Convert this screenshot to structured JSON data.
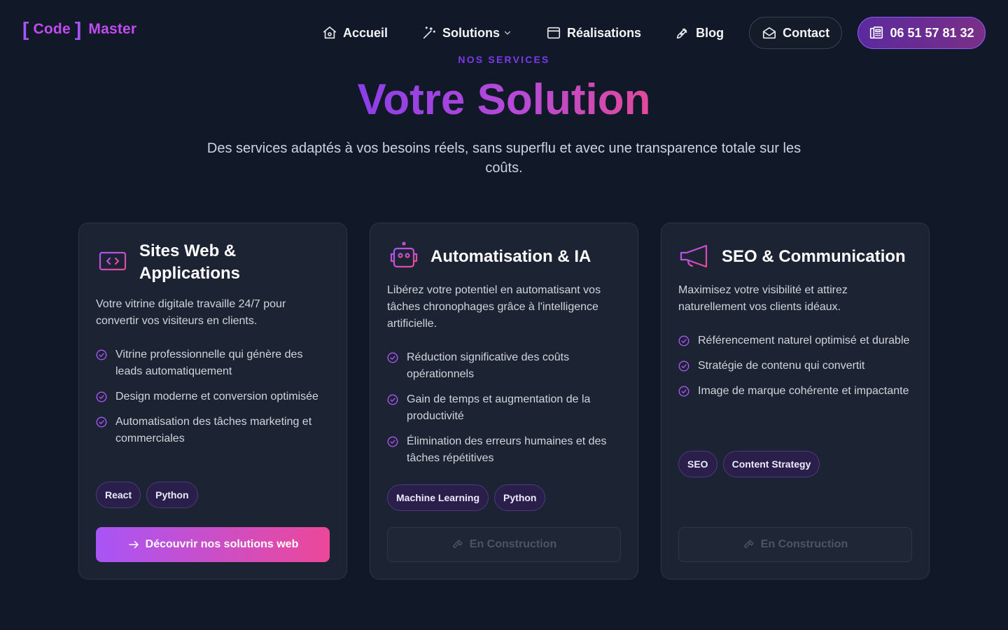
{
  "nav": {
    "logo": {
      "bracket_open": "[",
      "word1": "Code",
      "bracket_close": "]",
      "word2": "Master"
    },
    "links": [
      {
        "label": "Accueil",
        "icon": "home-icon"
      },
      {
        "label": "Solutions",
        "icon": "magic-wand-icon",
        "dropdown": true
      },
      {
        "label": "Réalisations",
        "icon": "browser-window-icon"
      },
      {
        "label": "Blog",
        "icon": "pen-nib-icon"
      },
      {
        "label": "Contact",
        "icon": "mail-open-icon"
      }
    ],
    "phone": {
      "label": "06 51 57 81 32",
      "icon": "phone-icon"
    }
  },
  "header": {
    "eyebrow": "NOS SERVICES",
    "title": "Votre Solution",
    "subtitle": "Des services adaptés à vos besoins réels, sans superflu et avec une transparence totale sur les coûts."
  },
  "cards": [
    {
      "icon": "laptop-code-icon",
      "title": "Sites Web & Applications",
      "description": "Votre vitrine digitale travaille 24/7 pour convertir vos visiteurs en clients.",
      "features": [
        "Vitrine professionnelle qui génère des leads automatiquement",
        "Design moderne et conversion optimisée",
        "Automatisation des tâches marketing et commerciales"
      ],
      "tags": [
        "React",
        "Python"
      ],
      "button": {
        "label": "Découvrir nos solutions web",
        "icon": "arrow-right-icon",
        "state": "active"
      }
    },
    {
      "icon": "robot-icon",
      "title": "Automatisation & IA",
      "description": "Libérez votre potentiel en automatisant vos tâches chronophages grâce à l'intelligence artificielle.",
      "features": [
        "Réduction significative des coûts opérationnels",
        "Gain de temps et augmentation de la productivité",
        "Élimination des erreurs humaines et des tâches répétitives"
      ],
      "tags": [
        "Machine Learning",
        "Python"
      ],
      "button": {
        "label": "En Construction",
        "icon": "hammer-icon",
        "state": "disabled"
      }
    },
    {
      "icon": "megaphone-icon",
      "title": "SEO & Communication",
      "description": "Maximisez votre visibilité et attirez naturellement vos clients idéaux.",
      "features": [
        "Référencement naturel optimisé et durable",
        "Stratégie de contenu qui convertit",
        "Image de marque cohérente et impactante"
      ],
      "tags": [
        "SEO",
        "Content Strategy"
      ],
      "button": {
        "label": "En Construction",
        "icon": "hammer-icon",
        "state": "disabled"
      }
    }
  ],
  "colors": {
    "background": "#111827",
    "card": "#1c2333",
    "accent_purple": "#a855f7",
    "accent_pink": "#ec4899"
  }
}
